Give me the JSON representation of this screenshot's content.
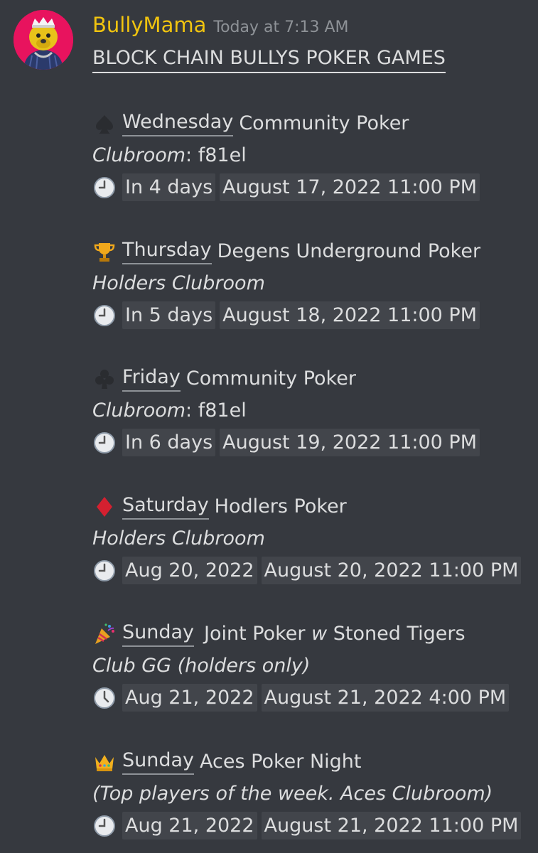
{
  "message": {
    "username": "BullyMama",
    "timestamp": "Today at 7:13 AM",
    "headline": "BLOCK CHAIN BULLYS POKER GAMES"
  },
  "events": [
    {
      "emoji": "spade-icon",
      "day": "Wednesday",
      "title": "Community Poker",
      "sub_italic": "Clubroom",
      "sub_plain": ": f81el",
      "relative": "In 4 days",
      "absolute": "August 17, 2022 11:00 PM"
    },
    {
      "emoji": "trophy-icon",
      "day": "Thursday",
      "title": "Degens Underground Poker",
      "sub_italic": "Holders Clubroom",
      "sub_plain": "",
      "relative": "In 5 days",
      "absolute": "August 18, 2022 11:00 PM"
    },
    {
      "emoji": "club-icon",
      "day": "Friday",
      "title": "Community Poker",
      "sub_italic": "Clubroom",
      "sub_plain": ": f81el",
      "relative": "In 6 days",
      "absolute": "August 19, 2022 11:00 PM"
    },
    {
      "emoji": "diamond-icon",
      "day": "Saturday",
      "title": "Hodlers Poker",
      "sub_italic": "Holders Clubroom",
      "sub_plain": "",
      "relative": "Aug 20, 2022",
      "absolute": "August 20, 2022 11:00 PM"
    },
    {
      "emoji": "party-popper-icon",
      "day": "Sunday",
      "title_plain_1": "Joint Poker ",
      "title_italic": "w",
      "title_plain_2": " Stoned Tigers",
      "sub_italic": "Club GG (holders only)",
      "sub_plain": "",
      "relative": "Aug 21, 2022",
      "absolute": "August 21, 2022 4:00 PM"
    },
    {
      "emoji": "crown-icon",
      "day": "Sunday",
      "title": "Aces Poker Night",
      "sub_italic": "(Top players of the week. Aces Clubroom)",
      "sub_plain": "",
      "relative": "Aug 21, 2022",
      "absolute": "August 21, 2022 11:00 PM"
    }
  ],
  "colors": {
    "background": "#36393f",
    "username": "#f1c40f",
    "text": "#dcddde",
    "timestamp_bg": "#42454b",
    "avatar_bg": "#e8135e"
  }
}
